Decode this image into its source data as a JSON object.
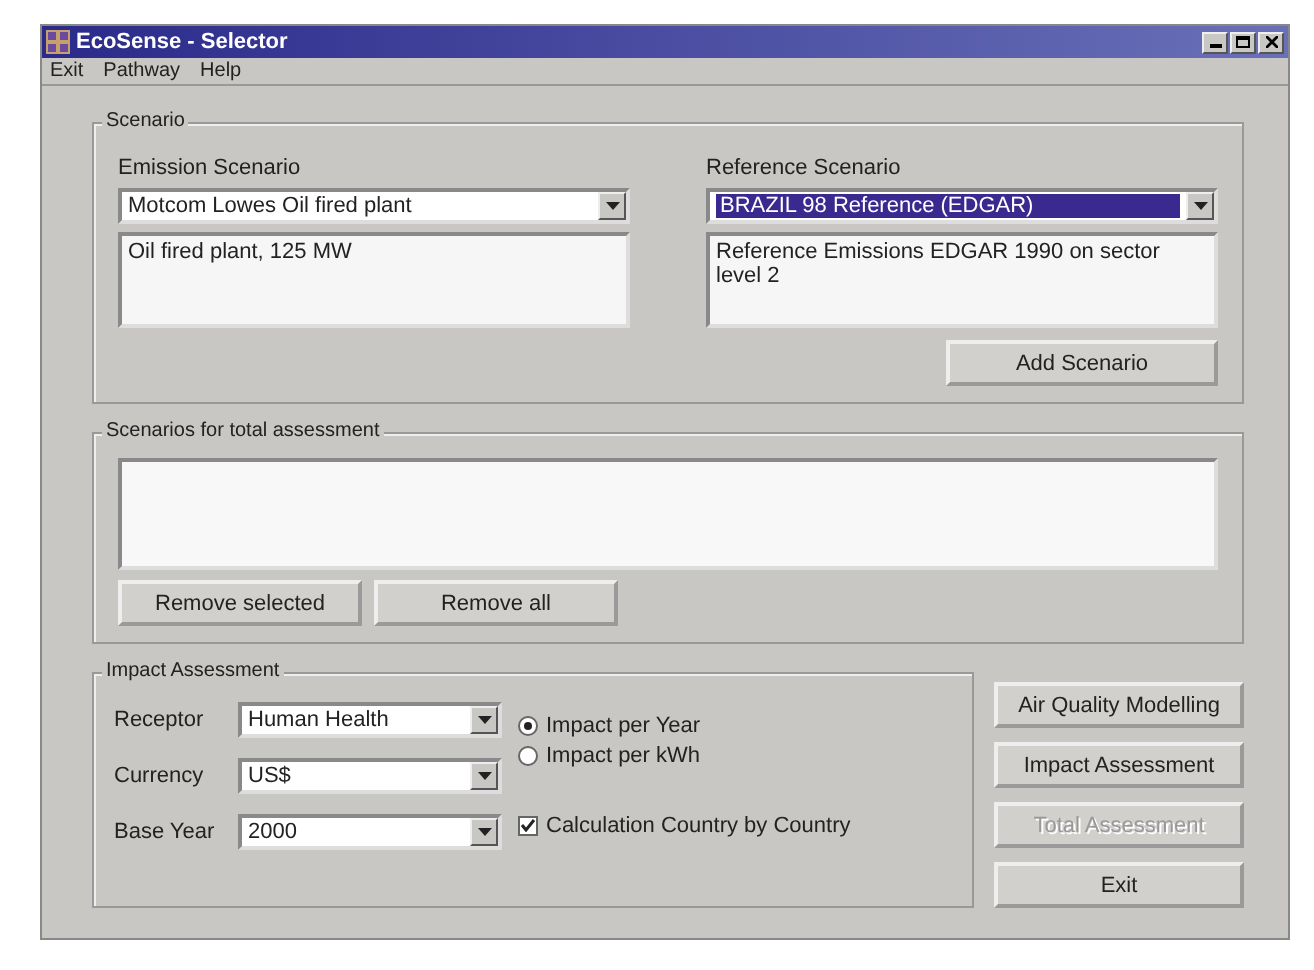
{
  "window": {
    "title": "EcoSense - Selector"
  },
  "menu": [
    {
      "label": "Exit"
    },
    {
      "label": "Pathway"
    },
    {
      "label": "Help"
    }
  ],
  "scenario": {
    "title": "Scenario",
    "emission": {
      "label": "Emission Scenario",
      "value": "Motcom Lowes Oil fired plant",
      "selected": false,
      "description": "Oil fired plant, 125 MW"
    },
    "reference": {
      "label": "Reference Scenario",
      "value": "BRAZIL 98 Reference (EDGAR)",
      "selected": true,
      "description": "Reference Emissions EDGAR 1990 on sector level 2"
    },
    "add_button": "Add Scenario"
  },
  "total": {
    "title": "Scenarios for total assessment",
    "buttons": [
      "Remove selected",
      "Remove all"
    ]
  },
  "impact": {
    "title": "Impact Assessment",
    "fields": [
      {
        "label": "Receptor",
        "value": "Human Health"
      },
      {
        "label": "Currency",
        "value": "US$"
      },
      {
        "label": "Base Year",
        "value": "2000"
      }
    ],
    "options": [
      {
        "kind": "radio",
        "label": "Impact per Year",
        "selected": true
      },
      {
        "kind": "radio",
        "label": "Impact per kWh",
        "selected": false
      },
      {
        "kind": "checkbox",
        "label": "Calculation Country by Country",
        "checked": true
      }
    ]
  },
  "actions": [
    {
      "label": "Air Quality Modelling",
      "disabled": false
    },
    {
      "label": "Impact Assessment",
      "disabled": false
    },
    {
      "label": "Total Assessment",
      "disabled": true
    },
    {
      "label": "Exit",
      "disabled": false
    }
  ]
}
